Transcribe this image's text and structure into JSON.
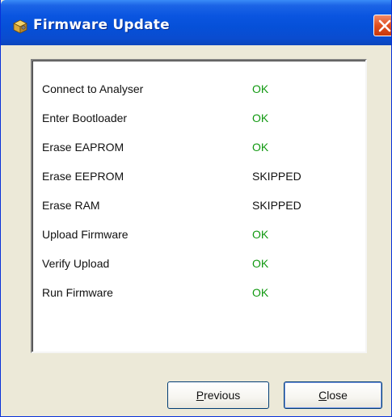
{
  "window": {
    "title": "Firmware Update",
    "icon": "firmware-package-icon",
    "close_icon": "close-icon"
  },
  "colors": {
    "titlebar": "#0a55e0",
    "status_ok": "#119911",
    "status_skipped": "#111111",
    "close_button": "#e0501f"
  },
  "steps": [
    {
      "label": "Connect to Analyser",
      "status": "OK"
    },
    {
      "label": "Enter Bootloader",
      "status": "OK"
    },
    {
      "label": "Erase EAPROM",
      "status": "OK"
    },
    {
      "label": "Erase EEPROM",
      "status": "SKIPPED"
    },
    {
      "label": "Erase RAM",
      "status": "SKIPPED"
    },
    {
      "label": "Upload Firmware",
      "status": "OK"
    },
    {
      "label": "Verify Upload",
      "status": "OK"
    },
    {
      "label": "Run Firmware",
      "status": "OK"
    }
  ],
  "buttons": {
    "previous": {
      "mnemonic": "P",
      "rest": "revious"
    },
    "close": {
      "mnemonic": "C",
      "rest": "lose"
    }
  }
}
